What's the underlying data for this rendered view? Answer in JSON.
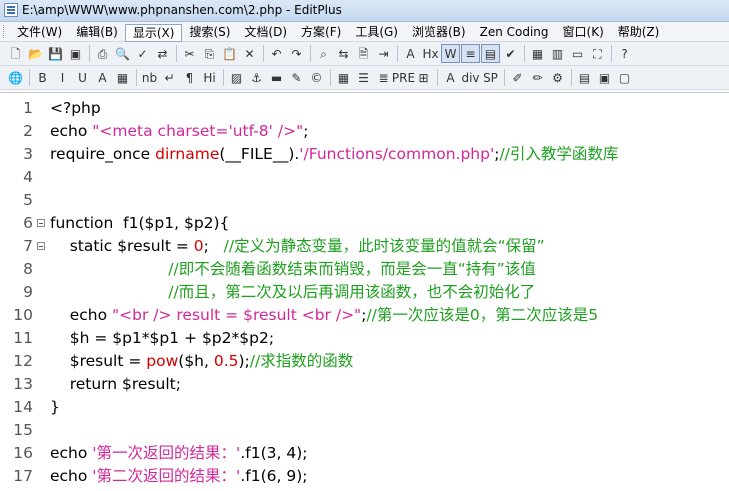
{
  "window": {
    "title": "E:\\amp\\WWW\\www.phpnanshen.com\\2.php - EditPlus"
  },
  "menu": [
    {
      "label": "文件(W)"
    },
    {
      "label": "编辑(B)"
    },
    {
      "label": "显示(X)",
      "active": true
    },
    {
      "label": "搜索(S)"
    },
    {
      "label": "文档(D)"
    },
    {
      "label": "方案(F)"
    },
    {
      "label": "工具(G)"
    },
    {
      "label": "浏览器(B)"
    },
    {
      "label": "Zen Coding"
    },
    {
      "label": "窗口(K)"
    },
    {
      "label": "帮助(Z)"
    }
  ],
  "toolbar1": [
    {
      "icon": "new-file-icon",
      "glyph": "🗋"
    },
    {
      "icon": "open-folder-icon",
      "glyph": "📂"
    },
    {
      "icon": "save-icon",
      "glyph": "💾"
    },
    {
      "icon": "save-all-icon",
      "glyph": "▣"
    },
    {
      "sep": true
    },
    {
      "icon": "print-icon",
      "glyph": "⎙"
    },
    {
      "icon": "print-preview-icon",
      "glyph": "🔍"
    },
    {
      "icon": "spellcheck-icon",
      "glyph": "✓"
    },
    {
      "icon": "file-transfer-icon",
      "glyph": "⇄"
    },
    {
      "sep": true
    },
    {
      "icon": "cut-icon",
      "glyph": "✂"
    },
    {
      "icon": "copy-icon",
      "glyph": "⎘"
    },
    {
      "icon": "paste-icon",
      "glyph": "📋"
    },
    {
      "icon": "delete-icon",
      "glyph": "✕"
    },
    {
      "sep": true
    },
    {
      "icon": "undo-icon",
      "glyph": "↶"
    },
    {
      "icon": "redo-icon",
      "glyph": "↷"
    },
    {
      "sep": true
    },
    {
      "icon": "find-icon",
      "glyph": "⌕"
    },
    {
      "icon": "replace-icon",
      "glyph": "⇆"
    },
    {
      "icon": "find-in-files-icon",
      "glyph": "🗎"
    },
    {
      "icon": "goto-line-icon",
      "glyph": "⇥"
    },
    {
      "sep": true
    },
    {
      "icon": "font-icon",
      "glyph": "A"
    },
    {
      "icon": "hex-icon",
      "glyph": "Hx"
    },
    {
      "icon": "word-wrap-icon",
      "glyph": "W",
      "pressed": true
    },
    {
      "icon": "line-number-icon",
      "glyph": "≡",
      "pressed": true
    },
    {
      "icon": "ruler-icon",
      "glyph": "▤",
      "pressed": true
    },
    {
      "icon": "checkmark-icon",
      "glyph": "✔"
    },
    {
      "sep": true
    },
    {
      "icon": "cliptext-icon",
      "glyph": "▦"
    },
    {
      "icon": "directory-icon",
      "glyph": "▥"
    },
    {
      "icon": "output-window-icon",
      "glyph": "▭"
    },
    {
      "icon": "fullscreen-icon",
      "glyph": "⛶"
    },
    {
      "sep": true
    },
    {
      "icon": "help-pointer-icon",
      "glyph": "?"
    }
  ],
  "toolbar2": [
    {
      "icon": "browser-icon",
      "glyph": "🌐"
    },
    {
      "sep": true
    },
    {
      "icon": "bold-icon",
      "glyph": "B"
    },
    {
      "icon": "italic-icon",
      "glyph": "I"
    },
    {
      "icon": "underline-icon",
      "glyph": "U"
    },
    {
      "icon": "font-color-icon",
      "glyph": "A"
    },
    {
      "icon": "color-table-icon",
      "glyph": "▦"
    },
    {
      "sep": true
    },
    {
      "icon": "nbsp-icon",
      "glyph": "nb"
    },
    {
      "icon": "line-break-icon",
      "glyph": "↵"
    },
    {
      "icon": "paragraph-icon",
      "glyph": "¶"
    },
    {
      "icon": "heading-icon",
      "glyph": "Hi"
    },
    {
      "sep": true
    },
    {
      "icon": "image-icon",
      "glyph": "▨"
    },
    {
      "icon": "anchor-icon",
      "glyph": "⚓"
    },
    {
      "icon": "horizontal-rule-icon",
      "glyph": "▬"
    },
    {
      "icon": "comment-icon",
      "glyph": "✎"
    },
    {
      "icon": "special-char-icon",
      "glyph": "©"
    },
    {
      "sep": true
    },
    {
      "icon": "table-icon",
      "glyph": "▦"
    },
    {
      "icon": "list-icon",
      "glyph": "☰"
    },
    {
      "icon": "center-icon",
      "glyph": "≣"
    },
    {
      "icon": "preformat-icon",
      "glyph": "PRE"
    },
    {
      "icon": "html-form-icon",
      "glyph": "⊞"
    },
    {
      "sep": true
    },
    {
      "icon": "html-toolbar-icon",
      "glyph": "A"
    },
    {
      "icon": "div-icon",
      "glyph": "div"
    },
    {
      "icon": "span-icon",
      "glyph": "SP"
    },
    {
      "sep": true
    },
    {
      "icon": "edit-tag-icon",
      "glyph": "✐"
    },
    {
      "icon": "brush-icon",
      "glyph": "✏"
    },
    {
      "icon": "tools-icon",
      "glyph": "⚙"
    },
    {
      "sep": true
    },
    {
      "icon": "panel-icon",
      "glyph": "▤"
    },
    {
      "icon": "split-window-icon",
      "glyph": "▣"
    },
    {
      "icon": "window-icon",
      "glyph": "▢"
    }
  ],
  "code_lines": [
    {
      "num": "1",
      "fold": false,
      "tokens": [
        {
          "c": "n",
          "t": "<?php"
        }
      ]
    },
    {
      "num": "2",
      "fold": false,
      "tokens": [
        {
          "c": "n",
          "t": "echo "
        },
        {
          "c": "s",
          "t": "\"<meta charset='utf-8' />\""
        },
        {
          "c": "n",
          "t": ";"
        }
      ]
    },
    {
      "num": "3",
      "fold": false,
      "tokens": [
        {
          "c": "n",
          "t": "require_once "
        },
        {
          "c": "f",
          "t": "dirname"
        },
        {
          "c": "n",
          "t": "(__FILE__)."
        },
        {
          "c": "s",
          "t": "'/Functions/common.php'"
        },
        {
          "c": "n",
          "t": ";"
        },
        {
          "c": "c",
          "t": "//引入教学函数库"
        }
      ]
    },
    {
      "num": "4",
      "fold": false,
      "tokens": []
    },
    {
      "num": "5",
      "fold": false,
      "tokens": []
    },
    {
      "num": "6",
      "fold": true,
      "tokens": [
        {
          "c": "n",
          "t": "function  f1($p1, $p2){"
        }
      ]
    },
    {
      "num": "7",
      "fold": true,
      "tokens": [
        {
          "c": "n",
          "t": "    static $result = "
        },
        {
          "c": "f",
          "t": "0"
        },
        {
          "c": "n",
          "t": ";   "
        },
        {
          "c": "c",
          "t": "//定义为静态变量，此时该变量的值就会“保留”"
        }
      ]
    },
    {
      "num": "8",
      "fold": false,
      "tokens": [
        {
          "c": "c",
          "t": "                        //即不会随着函数结束而销毁，而是会一直“持有”该值"
        }
      ]
    },
    {
      "num": "9",
      "fold": false,
      "tokens": [
        {
          "c": "c",
          "t": "                        //而且，第二次及以后再调用该函数，也不会初始化了"
        }
      ]
    },
    {
      "num": "10",
      "fold": false,
      "tokens": [
        {
          "c": "n",
          "t": "    echo "
        },
        {
          "c": "s",
          "t": "\"<br /> result = $result <br />\""
        },
        {
          "c": "n",
          "t": ";"
        },
        {
          "c": "c",
          "t": "//第一次应该是0，第二次应该是5"
        }
      ]
    },
    {
      "num": "11",
      "fold": false,
      "tokens": [
        {
          "c": "n",
          "t": "    $h = $p1*$p1 + $p2*$p2;"
        }
      ]
    },
    {
      "num": "12",
      "fold": false,
      "tokens": [
        {
          "c": "n",
          "t": "    $result = "
        },
        {
          "c": "f",
          "t": "pow"
        },
        {
          "c": "n",
          "t": "($h, "
        },
        {
          "c": "f",
          "t": "0.5"
        },
        {
          "c": "n",
          "t": ");"
        },
        {
          "c": "c",
          "t": "//求指数的函数"
        }
      ]
    },
    {
      "num": "13",
      "fold": false,
      "tokens": [
        {
          "c": "n",
          "t": "    return $result;"
        }
      ]
    },
    {
      "num": "14",
      "fold": false,
      "tokens": [
        {
          "c": "n",
          "t": "}"
        }
      ]
    },
    {
      "num": "15",
      "fold": false,
      "tokens": []
    },
    {
      "num": "16",
      "fold": false,
      "tokens": [
        {
          "c": "n",
          "t": "echo "
        },
        {
          "c": "s",
          "t": "'第一次返回的结果：'"
        },
        {
          "c": "n",
          "t": ".f1(3, 4);"
        }
      ]
    },
    {
      "num": "17",
      "fold": false,
      "tokens": [
        {
          "c": "n",
          "t": "echo "
        },
        {
          "c": "s",
          "t": "'第二次返回的结果：'"
        },
        {
          "c": "n",
          "t": ".f1(6, 9);"
        }
      ]
    }
  ],
  "colors": {
    "keyword": "#00008b",
    "string": "#d1289b",
    "function": "#d40000",
    "comment": "#20a020"
  }
}
